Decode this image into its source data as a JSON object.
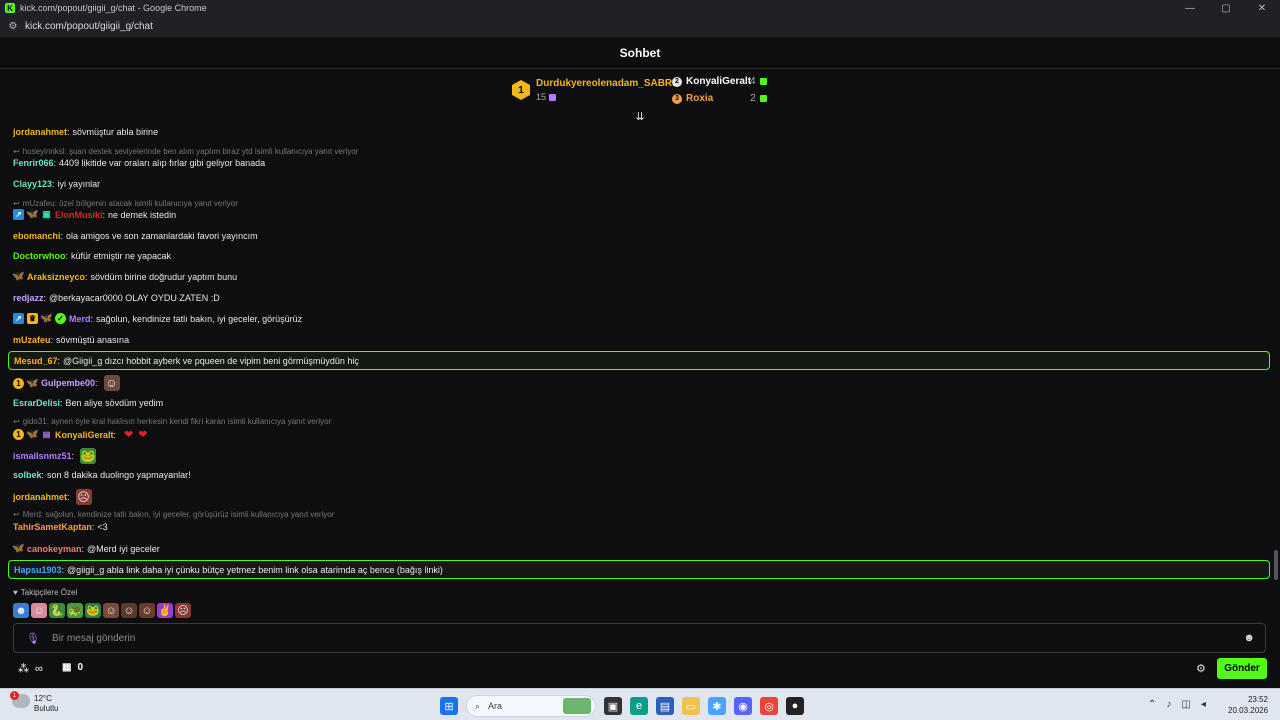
{
  "window": {
    "title": "kick.com/popout/giigii_g/chat - Google Chrome",
    "url": "kick.com/popout/giigii_g/chat",
    "controls": [
      "—",
      "▢",
      "✕"
    ]
  },
  "chat": {
    "title": "Sohbet"
  },
  "leaderboard": {
    "first": {
      "rank": "1",
      "name": "Durdukyereolenadam_SABRI",
      "points": "15"
    },
    "others": [
      {
        "name": "KonyaliGeralt",
        "count": "4",
        "color": "#ffffff"
      },
      {
        "name": "Roxia",
        "count": "2",
        "color": "#f0a24a"
      }
    ]
  },
  "messages": [
    {
      "user": "jordanahmet",
      "text": "sövmüştur abla birine",
      "color": "#f3b71b"
    },
    {
      "reply": "huseyinnksl: şuan destek seviyelerinde ben alım yaptım biraz ytd isimli kullanıcıya yanıt veriyor"
    },
    {
      "user": "Fenrir066",
      "text": "4409 likitide var oraları alıp fırlar gibi geliyor banada",
      "color": "#6ee6c4"
    },
    {
      "user": "Clayy123",
      "text": "iyi yayınlar",
      "color": "#6ee6c4"
    },
    {
      "reply": "mUzafeu: özel bölgenin atacak isimli kullanıcıya yanıt veriyor"
    },
    {
      "user": "ElonMusiki",
      "text": "ne demek istedin",
      "color": "#e0222b"
    },
    {
      "user": "ebomanchi",
      "text": "ola amigos ve son zamanlardaki favori yayıncım",
      "color": "#f3b71b"
    },
    {
      "user": "Doctorwhoo",
      "text": "küfür etmiştir ne yapacak",
      "color": "#53fc18"
    },
    {
      "user": "Araksizneyco",
      "text": "sövdüm birine doğrudur yaptım bunu",
      "color": "#f3b71b"
    },
    {
      "user": "redjazz",
      "text": "@berkayacar0000 OLAY OYDU ZATEN :D",
      "color": "#c9a0ff"
    },
    {
      "user": "Merd",
      "text": "sağolun, kendinize tatlı bakın, iyi geceler, görüşürüz",
      "color": "#b37dff"
    },
    {
      "user": "mUzafeu",
      "text": "sövmüştü anasına",
      "color": "#f3b71b"
    },
    {
      "user": "Mesud_67",
      "text": "@Giigii_g dızcı hobbit ayberk ve pqueen de vipim beni görmüşmüydün hiç",
      "color": "#f3b71b"
    },
    {
      "user": "Gulpembe00",
      "text": "",
      "color": "#c9a0ff"
    },
    {
      "user": "EsrarDelisi",
      "text": "Ben aliye sövdüm yedim",
      "color": "#6ee6c4"
    },
    {
      "reply": "gido31: aynen öyle kral haklısın herkesin kendi fikri karan isimli kullanıcıya yanıt veriyor"
    },
    {
      "user": "KonyaliGeralt",
      "text": "",
      "color": "#f3b71b"
    },
    {
      "user": "ismailsnmz51",
      "text": "",
      "color": "#b37dff"
    },
    {
      "user": "solbek",
      "text": "son 8 dakika duolingo yapmayanlar!",
      "color": "#6ee6c4"
    },
    {
      "user": "jordanahmet",
      "text": "",
      "color": "#f3b71b"
    },
    {
      "reply": "Merd: sağolun, kendinize tatlı bakın, iyi geceler, görüşürüz isimli kullanıcıya yanıt veriyor"
    },
    {
      "user": "TahirSametKaptan",
      "text": "<3",
      "color": "#f0a24a"
    },
    {
      "user": "canokeyman",
      "text": "@Merd iyi geceler",
      "color": "#f07a7a"
    },
    {
      "user": "Hapsu1903",
      "text": "@giigii_g abla link daha iyi çünku bütçe yetmez benim link olsa atarimda aç bence (bağış linki)",
      "color": "#4aa3ff"
    }
  ],
  "followers_only": {
    "label": "Takipçilere Özel"
  },
  "input": {
    "placeholder": "Bir mesaj gönderin"
  },
  "toolbar": {
    "infinity": "∞",
    "store_count": "0",
    "send_label": "Gönder"
  },
  "taskbar": {
    "weather_temp": "12°C",
    "weather_desc": "Bulutlu",
    "weather_badge": "1",
    "search_placeholder": "Ara",
    "time": "23:52",
    "date": "20.03.2026"
  }
}
